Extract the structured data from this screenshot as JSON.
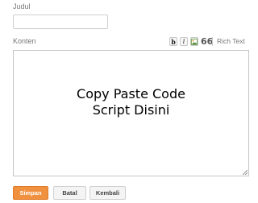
{
  "form": {
    "title_label": "Judul",
    "title_value": "",
    "content_label": "Konten",
    "content_text_line1": "Copy Paste Code",
    "content_text_line2": "Script Disini"
  },
  "toolbar": {
    "bold": "b",
    "italic": "i",
    "image_icon": "image-icon",
    "quote": "66",
    "rich_text": "Rich Text"
  },
  "buttons": {
    "save": "Simpan",
    "cancel": "Batal",
    "back": "Kembali"
  },
  "colors": {
    "save_button": "#f0913f",
    "label_text": "#777777",
    "border": "#c4c4c4"
  }
}
